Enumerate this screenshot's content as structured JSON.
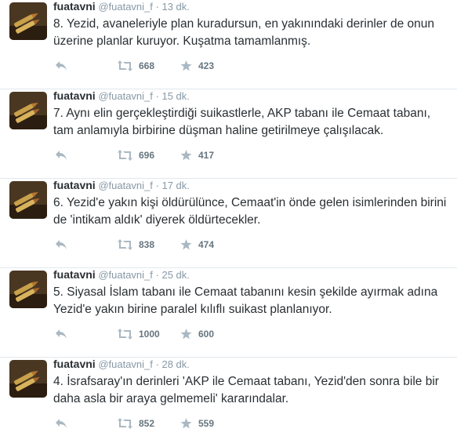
{
  "tweets": [
    {
      "name": "fuatavni",
      "handle": "@fuatavni_f",
      "sep": "·",
      "time": "13 dk.",
      "text": "8. Yezid, avaneleriyle plan kuradursun, en yakınındaki derinler de onun üzerine planlar kuruyor. Kuşatma tamamlanmış.",
      "retweets": "668",
      "favorites": "423"
    },
    {
      "name": "fuatavni",
      "handle": "@fuatavni_f",
      "sep": "·",
      "time": "15 dk.",
      "text": "7. Aynı elin gerçekleştirdiği suikastlerle, AKP tabanı ile Cemaat tabanı, tam anlamıyla birbirine düşman haline getirilmeye çalışılacak.",
      "retweets": "696",
      "favorites": "417"
    },
    {
      "name": "fuatavni",
      "handle": "@fuatavni_f",
      "sep": "·",
      "time": "17 dk.",
      "text": "6. Yezid'e yakın kişi öldürülünce, Cemaat'in önde gelen isimlerinden birini de 'intikam aldık' diyerek öldürtecekler.",
      "retweets": "838",
      "favorites": "474"
    },
    {
      "name": "fuatavni",
      "handle": "@fuatavni_f",
      "sep": "·",
      "time": "25 dk.",
      "text": "5. Siyasal İslam tabanı ile Cemaat tabanını kesin şekilde ayırmak adına Yezid'e yakın birine paralel kılıflı suikast planlanıyor.",
      "retweets": "1000",
      "favorites": "600"
    },
    {
      "name": "fuatavni",
      "handle": "@fuatavni_f",
      "sep": "·",
      "time": "28 dk.",
      "text": "4. İsrafsaray'ın derinleri 'AKP ile Cemaat tabanı, Yezid'den sonra bile bir daha asla bir araya gelmemeli' kararındalar.",
      "retweets": "852",
      "favorites": "559"
    }
  ],
  "icons": {
    "reply": "reply-icon",
    "retweet": "retweet-icon",
    "favorite": "star-icon",
    "avatar": "bullets-avatar"
  },
  "colors": {
    "action_icon": "#aab8c2",
    "count": "#66757f",
    "secondary_text": "#8899a6",
    "divider": "#e1e8ed"
  }
}
